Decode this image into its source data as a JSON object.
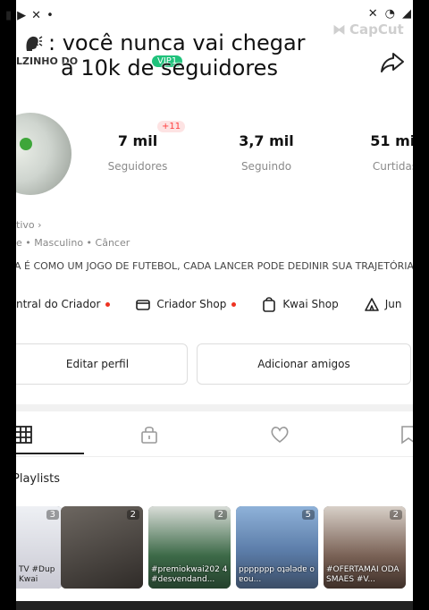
{
  "overlay": {
    "caption_line1": ": você nunca vai chegar",
    "caption_line2": "a 10k de seguidores",
    "watermark": "CapCut"
  },
  "profile": {
    "username_partial": "LZINHO DO",
    "vip_badge": "VIP1"
  },
  "stats": {
    "followers": {
      "value": "7 mil",
      "label": "Seguidores",
      "badge": "+11"
    },
    "following": {
      "value": "3,7 mil",
      "label": "Seguindo"
    },
    "likes": {
      "value": "51 mil",
      "label": "Curtidas"
    }
  },
  "info": {
    "status_line": "tivo ›",
    "tags": "e • Masculino • Câncer",
    "bio": "A É COMO UM JOGO DE FUTEBOL, CADA LANCER PODE DEDINIR SUA TRAJETÓRIA"
  },
  "shortcuts": [
    {
      "label": "ntral do Criador",
      "icon": "chart-icon",
      "dot": true
    },
    {
      "label": "Criador Shop",
      "icon": "shop-icon",
      "dot": true
    },
    {
      "label": "Kwai Shop",
      "icon": "bag-icon",
      "dot": false
    },
    {
      "label": "Jun",
      "icon": "tent-icon",
      "dot": false
    }
  ],
  "buttons": {
    "edit_profile": "Editar perfil",
    "add_friends": "Adicionar amigos"
  },
  "tabs": [
    "grid-icon",
    "lock-icon",
    "heart-icon",
    "bookmark-icon"
  ],
  "playlists": {
    "title": "Playlists",
    "items": [
      {
        "count": "3",
        "caption": "TV #Dup Kwai",
        "color": "#c9c9d3"
      },
      {
        "count": "2",
        "caption": "",
        "color": "#4a4540"
      },
      {
        "count": "2",
        "caption": "#premiokwai202 4 #desvendand...",
        "color": "#3d6a48"
      },
      {
        "count": "5",
        "caption": "ppppppp oʇǝlǝdɐ o ɐou...",
        "color": "#5b7ca8"
      },
      {
        "count": "2",
        "caption": "#OFERTAMAI ODASMAES #V...",
        "color": "#7a6256"
      }
    ]
  }
}
